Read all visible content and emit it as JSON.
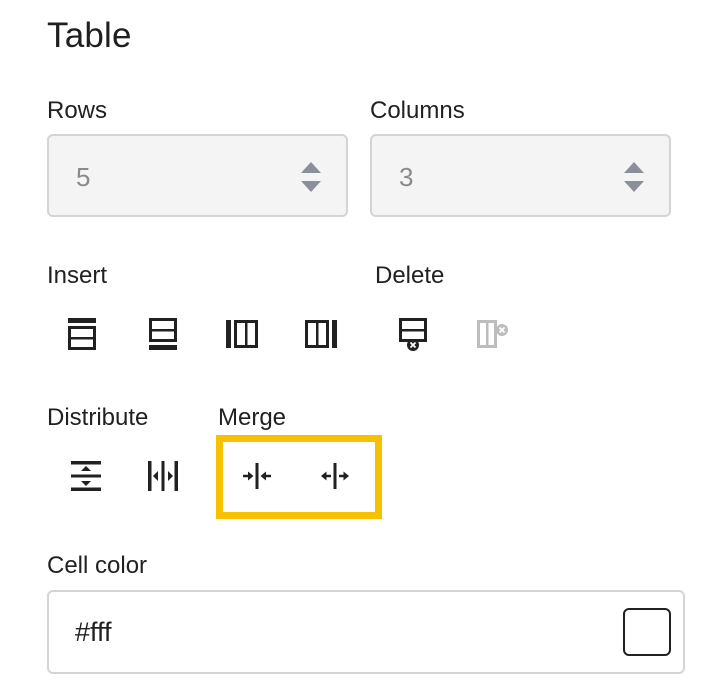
{
  "panel": {
    "title": "Table"
  },
  "rows": {
    "label": "Rows",
    "value": "5"
  },
  "columns": {
    "label": "Columns",
    "value": "3"
  },
  "insert": {
    "label": "Insert"
  },
  "delete": {
    "label": "Delete"
  },
  "distribute": {
    "label": "Distribute"
  },
  "merge": {
    "label": "Merge",
    "highlight_color": "#f6c200"
  },
  "cell_color": {
    "label": "Cell color",
    "value": "#fff",
    "swatch": "#ffffff"
  },
  "icons": [
    "insert-row-above-icon",
    "insert-row-below-icon",
    "insert-column-left-icon",
    "insert-column-right-icon",
    "delete-row-icon",
    "delete-column-icon",
    "distribute-rows-icon",
    "distribute-columns-icon",
    "merge-cells-icon",
    "split-cells-icon"
  ]
}
